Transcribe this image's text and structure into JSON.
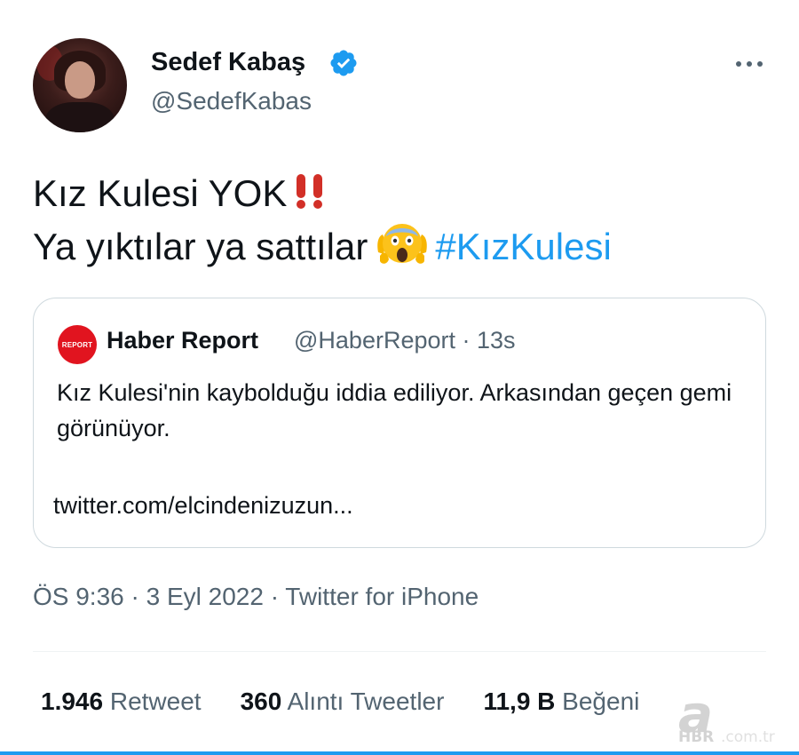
{
  "author": {
    "display_name": "Sedef Kabaş",
    "handle": "@SedefKabas",
    "verified_icon": "verified-badge-icon",
    "verified_color": "#1d9bf0"
  },
  "tweet": {
    "line1_text": "Kız Kulesi YOK",
    "line1_emoji": "double-exclamation-icon",
    "line2_text": "Ya yıktılar ya sattılar",
    "line2_emoji": "screaming-face-icon",
    "hashtag": "#KızKulesi"
  },
  "quote": {
    "avatar_text": "REPORT",
    "name": "Haber Report",
    "handle_time": "@HaberReport · 13s",
    "text": "Kız Kulesi'nin kaybolduğu iddia ediliyor. Arkasından geçen gemi görünüyor.",
    "link": "twitter.com/elcindenizuzun..."
  },
  "meta": {
    "line": "ÖS 9:36 · 3 Eyl 2022 · Twitter for iPhone"
  },
  "stats": [
    {
      "count": "1.946",
      "label": "Retweet"
    },
    {
      "count": "360",
      "label": "Alıntı Tweetler"
    },
    {
      "count": "11,9 B",
      "label": "Beğeni"
    }
  ],
  "watermark": {
    "mark": "a",
    "brand": "HBR",
    "suffix": ".com.tr"
  },
  "colors": {
    "text": "#0f1419",
    "muted": "#536471",
    "link": "#1d9bf0",
    "border": "#cfd9de",
    "quote_avatar": "#e1141f"
  }
}
